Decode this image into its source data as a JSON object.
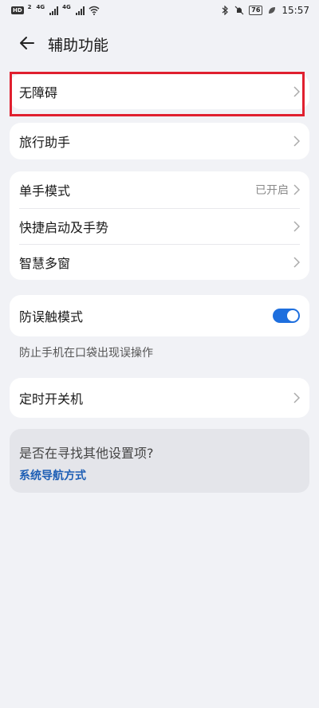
{
  "status_bar": {
    "badge": "HD",
    "sim1_label": "2",
    "net1": "4G",
    "net2": "4G",
    "battery": "76",
    "time": "15:57"
  },
  "header": {
    "title": "辅助功能"
  },
  "groups": {
    "accessibility": {
      "label": "无障碍"
    },
    "travel": {
      "label": "旅行助手"
    },
    "one_hand": {
      "label": "单手模式",
      "value": "已开启"
    },
    "shortcuts": {
      "label": "快捷启动及手势"
    },
    "multi_window": {
      "label": "智慧多窗"
    },
    "pocket_mode": {
      "label": "防误触模式",
      "enabled": true,
      "description": "防止手机在口袋出现误操作"
    },
    "scheduled_power": {
      "label": "定时开关机"
    }
  },
  "suggestion": {
    "question": "是否在寻找其他设置项?",
    "link": "系统导航方式"
  },
  "colors": {
    "accent": "#1e6fde",
    "highlight": "#e0202f",
    "link": "#1e5fb5"
  }
}
